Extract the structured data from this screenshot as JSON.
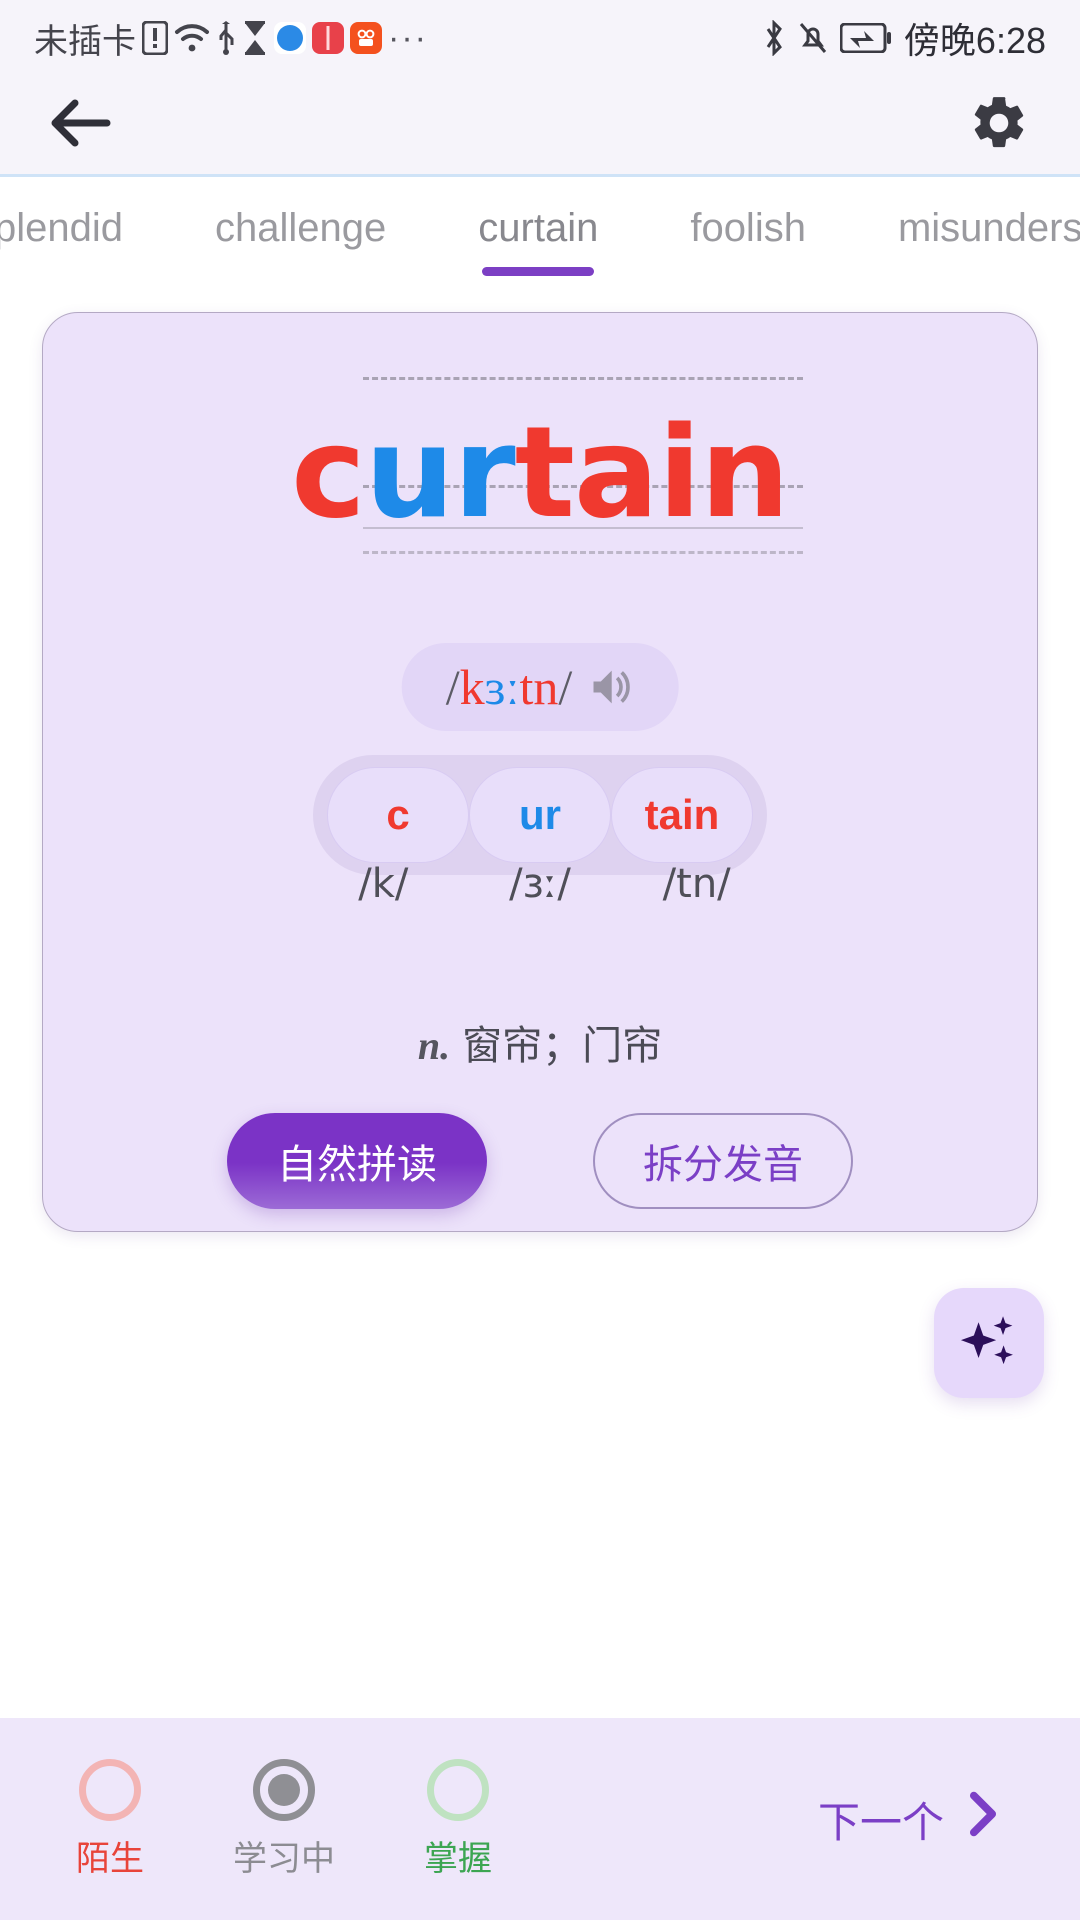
{
  "status_bar": {
    "carrier": "未插卡",
    "time": "傍晚6:28",
    "icons": [
      "sim-missing-icon",
      "wifi-icon",
      "usb-icon",
      "hourglass-icon",
      "browser-app-icon",
      "book-app-icon",
      "video-app-icon",
      "more-dots-icon",
      "bluetooth-icon",
      "notifications-muted-icon",
      "battery-charging-icon"
    ]
  },
  "app_bar": {
    "back_icon": "back-arrow-icon",
    "settings_icon": "gear-icon"
  },
  "tabs": {
    "items": [
      {
        "label": "plendid",
        "active": false
      },
      {
        "label": "challenge",
        "active": false
      },
      {
        "label": "curtain",
        "active": true
      },
      {
        "label": "foolish",
        "active": false
      },
      {
        "label": "misunders",
        "active": false
      }
    ]
  },
  "card": {
    "word": {
      "full": "curtain",
      "segments": [
        {
          "text": "c",
          "color": "#f0392f"
        },
        {
          "text": "ur",
          "color": "#1e8ae8"
        },
        {
          "text": "tain",
          "color": "#f0392f"
        }
      ]
    },
    "phonetic": {
      "open_slash": "/",
      "close_slash": "/",
      "segments": [
        {
          "text": "k",
          "color": "#f0392f"
        },
        {
          "text": "ɜː",
          "color": "#1e8ae8"
        },
        {
          "text": "tn",
          "color": "#f0392f"
        }
      ],
      "speaker_icon": "speaker-icon"
    },
    "syllables": [
      {
        "letters": "c",
        "color": "#f0392f",
        "ipa": "/k/"
      },
      {
        "letters": "ur",
        "color": "#1e8ae8",
        "ipa": "/ɜː/"
      },
      {
        "letters": "tain",
        "color": "#f0392f",
        "ipa": "/tn/"
      }
    ],
    "definition": {
      "pos": "n.",
      "meaning": "窗帘；门帘"
    },
    "actions": {
      "primary_label": "自然拼读",
      "secondary_label": "拆分发音"
    }
  },
  "fab": {
    "icon": "sparkles-icon"
  },
  "bottom_bar": {
    "states": [
      {
        "label": "陌生",
        "color": "#e8443a",
        "ring_color": "#f3b4b4",
        "selected": false
      },
      {
        "label": "学习中",
        "color": "#8c8c92",
        "ring_color": "#8f8f94",
        "selected": true
      },
      {
        "label": "掌握",
        "color": "#3ca552",
        "ring_color": "#bfe2c1",
        "selected": false
      }
    ],
    "next_label": "下一个",
    "next_icon": "chevron-right-icon"
  },
  "colors": {
    "accent_purple": "#7b3fc6",
    "card_bg": "#ece2fa",
    "red": "#f0392f",
    "blue": "#1e8ae8"
  }
}
